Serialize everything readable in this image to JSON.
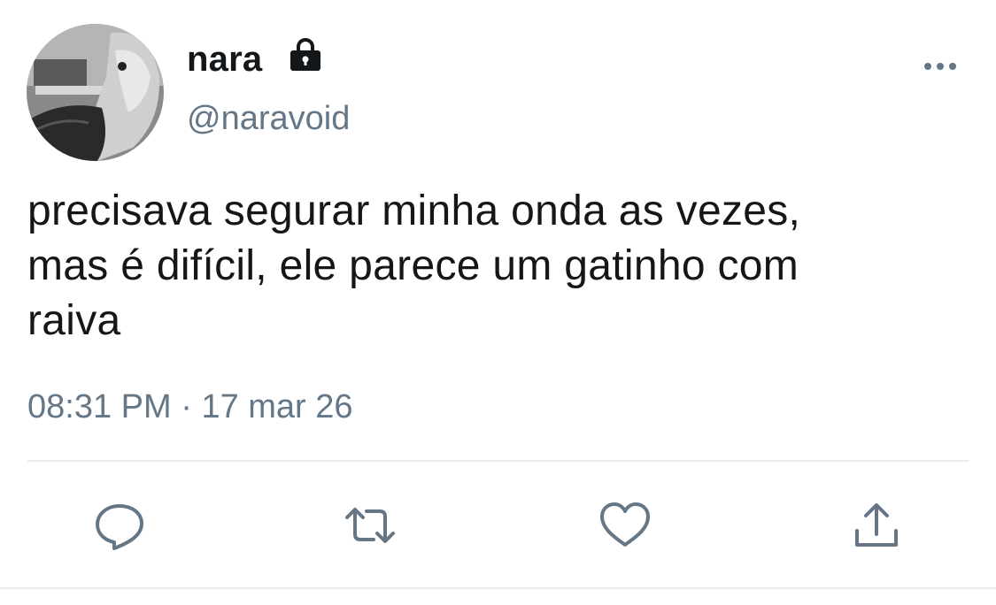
{
  "tweet": {
    "author": {
      "display_name": "nara",
      "handle": "@naravoid",
      "protected_icon": "lock-icon"
    },
    "text_lines": [
      "precisava segurar minha onda as vezes,",
      "mas é difícil, ele parece um gatinho com",
      "raiva"
    ],
    "time": "08:31 PM",
    "separator": "·",
    "date": "17 mar 26"
  },
  "actions": [
    {
      "name": "reply",
      "icon": "speech-bubble-icon"
    },
    {
      "name": "retweet",
      "icon": "retweet-arrows-icon"
    },
    {
      "name": "like",
      "icon": "heart-icon"
    },
    {
      "name": "share",
      "icon": "share-upload-icon"
    }
  ],
  "colors": {
    "primary_text": "#14171a",
    "secondary_text": "#657786",
    "icon": "#657786",
    "divider": "#e6ecf0"
  }
}
